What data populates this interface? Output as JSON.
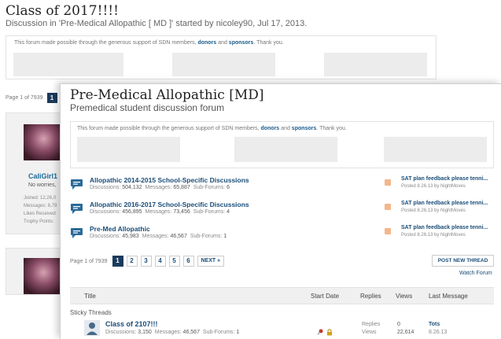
{
  "back": {
    "title": "Class of 2017!!!!",
    "subtitle": "Discussion in 'Pre-Medical Allopathic [ MD ]' started by nicoley90, Jul 17, 2013.",
    "notice": {
      "before": "This forum made possible through the generous support of SDN members,",
      "donors": "donors",
      "and": "and",
      "sponsors": "sponsors",
      "after": ". Thank you."
    },
    "pager": {
      "label": "Page 1 of 7939",
      "current": "1"
    },
    "user": {
      "name": "CaliGirl1",
      "status": "No worries,",
      "joined": "Joined: 12,26,0",
      "messages": "Messages: 8,79",
      "likes": "Likes Received",
      "trophy": "Trophy Points:"
    }
  },
  "front": {
    "title": "Pre-Medical Allopathic [MD]",
    "subtitle": "Premedical student discussion forum",
    "notice": {
      "before": "This forum made possible through the generous support of SDN members,",
      "donors": "donors",
      "and": "and",
      "sponsors": "sponsors",
      "after": ". Thank you."
    },
    "forums": [
      {
        "name": "Allopathic 2014-2015 School-Specific Discussions",
        "discussions_label": "Discussions:",
        "discussions": "504,132",
        "messages_label": "Messages:",
        "messages": "65,887",
        "subforums_label": "Sub-Forums:",
        "subforums": "6",
        "last_title": "SAT plan feedback please tenni...",
        "last_meta": "Posted 8.26.13 by NightMoves"
      },
      {
        "name": "Allopathic 2016-2017 School-Specific Discussions",
        "discussions_label": "Discussions:",
        "discussions": "456,895",
        "messages_label": "Messages:",
        "messages": "73,456",
        "subforums_label": "Sub-Forums:",
        "subforums": "4",
        "last_title": "SAT plan feedback please tenni...",
        "last_meta": "Posted 8.26.13 by NightMoves"
      },
      {
        "name": "Pre-Med Allopathic",
        "discussions_label": "Discussions:",
        "discussions": "45,983",
        "messages_label": "Messages:",
        "messages": "46,567",
        "subforums_label": "Sub-Forums:",
        "subforums": "1",
        "last_title": "SAT plan feedback please tenni...",
        "last_meta": "Posted 8.26.13 by NightMoves"
      }
    ],
    "pager": {
      "label": "Page 1 of 7939",
      "pages": [
        "1",
        "2",
        "3",
        "4",
        "5",
        "6"
      ],
      "next": "NEXT »"
    },
    "post_button": "POST NEW THREAD",
    "watch_link": "Watch Forum",
    "table": {
      "headers": {
        "title": "Title",
        "start_date": "Start Date",
        "replies": "Replies",
        "views": "Views",
        "last_message": "Last Message"
      },
      "section": "Sticky Threads",
      "thread": {
        "title": "Class of 2107!!!",
        "discussions_label": "Discussions:",
        "discussions": "3,150",
        "messages_label": "Messages:",
        "messages": "46,567",
        "subforums_label": "Sub-Forums:",
        "subforums": "1",
        "replies_label": "Replies",
        "replies": "0",
        "views_label": "Views",
        "views": "22,614",
        "last_user": "Tots",
        "last_date": "8.26.13"
      }
    },
    "colors": {
      "accent": "#1b3a5b",
      "link": "#1a4d78",
      "rss": "#f4b68a"
    }
  }
}
